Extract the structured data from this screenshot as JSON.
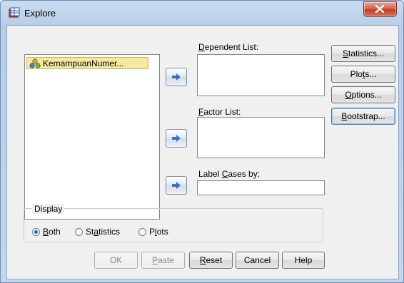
{
  "window": {
    "title": "Explore",
    "close_label": "x"
  },
  "source": {
    "items": [
      {
        "label": "KemampuanNumer..."
      }
    ]
  },
  "fields": {
    "dependent": {
      "label_pre": "",
      "label_key": "D",
      "label_post": "ependent List:"
    },
    "factor": {
      "label_pre": "",
      "label_key": "F",
      "label_post": "actor List:"
    },
    "label_cases": {
      "label_pre": "Label ",
      "label_key": "C",
      "label_post": "ases by:"
    }
  },
  "side_buttons": {
    "statistics": {
      "pre": "",
      "key": "S",
      "post": "tatistics..."
    },
    "plots": {
      "pre": "Plo",
      "key": "t",
      "post": "s..."
    },
    "options": {
      "pre": "",
      "key": "O",
      "post": "ptions..."
    },
    "bootstrap": {
      "pre": "",
      "key": "B",
      "post": "ootstrap..."
    }
  },
  "display": {
    "title": "Display",
    "options": [
      {
        "pre": "",
        "key": "B",
        "post": "oth",
        "checked": true
      },
      {
        "pre": "St",
        "key": "a",
        "post": "tistics",
        "checked": false
      },
      {
        "pre": "P",
        "key": "l",
        "post": "ots",
        "checked": false
      }
    ]
  },
  "bottom_buttons": {
    "ok": {
      "pre": "OK",
      "key": "",
      "post": ""
    },
    "paste": {
      "pre": "",
      "key": "P",
      "post": "aste"
    },
    "reset": {
      "pre": "",
      "key": "R",
      "post": "eset"
    },
    "cancel": {
      "pre": "Cancel",
      "key": "",
      "post": ""
    },
    "help": {
      "pre": "Help",
      "key": "",
      "post": ""
    }
  },
  "icons": {
    "app": "explore-app-icon",
    "variable": "scale-variable-icon",
    "move_arrow": "right-arrow-icon",
    "close": "close-icon"
  },
  "colors": {
    "selected_item_bg": "#f5e9a1",
    "arrow_blue": "#2f73c8",
    "close_red": "#c23a24"
  }
}
